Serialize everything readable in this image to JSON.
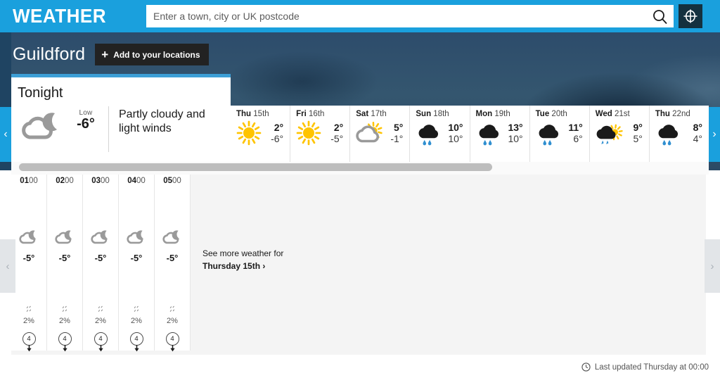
{
  "masthead": {
    "brand": "WEATHER",
    "search_placeholder": "Enter a town, city or UK postcode",
    "search_value": "",
    "search_icon": "search-icon",
    "location_icon": "crosshair-location-icon"
  },
  "location": {
    "name": "Guildford",
    "add_button_label": "Add to your locations",
    "add_button_plus": "+"
  },
  "tonight": {
    "title": "Tonight",
    "icon": "cloud-moon-icon",
    "low_label": "Low",
    "low_value": "-6°",
    "description": "Partly cloudy and light winds"
  },
  "nav": {
    "strip_left_arrow": "‹",
    "strip_right_arrow": "›",
    "hour_left_arrow": "‹",
    "hour_right_arrow": "›"
  },
  "days": [
    {
      "dow": "Thu ",
      "dom": "15th",
      "icon": "sunny-icon",
      "high": "2°",
      "low": "-6°",
      "bar_color": "#b7dede"
    },
    {
      "dow": "Fri ",
      "dom": "16th",
      "icon": "sunny-icon",
      "high": "2°",
      "low": "-5°",
      "bar_color": "#a8dcdc"
    },
    {
      "dow": "Sat ",
      "dom": "17th",
      "icon": "sunny-intervals-icon",
      "high": "5°",
      "low": "-1°",
      "bar_color": "#8ec96e"
    },
    {
      "dow": "Sun ",
      "dom": "18th",
      "icon": "light-rain-icon",
      "high": "10°",
      "low": "10°",
      "bar_color": "#cbd93c"
    },
    {
      "dow": "Mon ",
      "dom": "19th",
      "icon": "light-rain-icon",
      "high": "13°",
      "low": "10°",
      "bar_color": "#f7b500"
    },
    {
      "dow": "Tue ",
      "dom": "20th",
      "icon": "light-rain-icon",
      "high": "11°",
      "low": "6°",
      "bar_color": "#f5d80a"
    },
    {
      "dow": "Wed ",
      "dom": "21st",
      "icon": "sunny-showers-icon",
      "high": "9°",
      "low": "5°",
      "bar_color": "#c4d63e"
    },
    {
      "dow": "Thu ",
      "dom": "22nd",
      "icon": "light-rain-icon",
      "high": "8°",
      "low": "4°",
      "bar_color": "#9ecf5e"
    }
  ],
  "hours": [
    {
      "hh": "01",
      "mm": "00",
      "icon": "cloud-moon-icon",
      "temp": "-5°",
      "precip_icon": "drizzle-icon",
      "precip": "2%",
      "wind_speed": "4",
      "wind_dir_icon": "wind-arrow-south-icon"
    },
    {
      "hh": "02",
      "mm": "00",
      "icon": "cloud-moon-icon",
      "temp": "-5°",
      "precip_icon": "drizzle-icon",
      "precip": "2%",
      "wind_speed": "4",
      "wind_dir_icon": "wind-arrow-south-icon"
    },
    {
      "hh": "03",
      "mm": "00",
      "icon": "cloud-moon-icon",
      "temp": "-5°",
      "precip_icon": "drizzle-icon",
      "precip": "2%",
      "wind_speed": "4",
      "wind_dir_icon": "wind-arrow-south-icon"
    },
    {
      "hh": "04",
      "mm": "00",
      "icon": "cloud-moon-icon",
      "temp": "-5°",
      "precip_icon": "drizzle-icon",
      "precip": "2%",
      "wind_speed": "4",
      "wind_dir_icon": "wind-arrow-south-icon"
    },
    {
      "hh": "05",
      "mm": "00",
      "icon": "cloud-moon-icon",
      "temp": "-5°",
      "precip_icon": "drizzle-icon",
      "precip": "2%",
      "wind_speed": "4",
      "wind_dir_icon": "wind-arrow-south-icon"
    }
  ],
  "see_more": {
    "line1": "See more weather for",
    "line2": "Thursday 15th",
    "chevron": "›"
  },
  "footer": {
    "clock_icon": "clock-icon",
    "last_updated": "Last updated Thursday at 00:00"
  },
  "colors": {
    "brand_blue": "#1aa0dd",
    "dark_panel": "#14313f",
    "card_accent": "#3d9fd6",
    "rain_blue": "#2f8fd0"
  }
}
